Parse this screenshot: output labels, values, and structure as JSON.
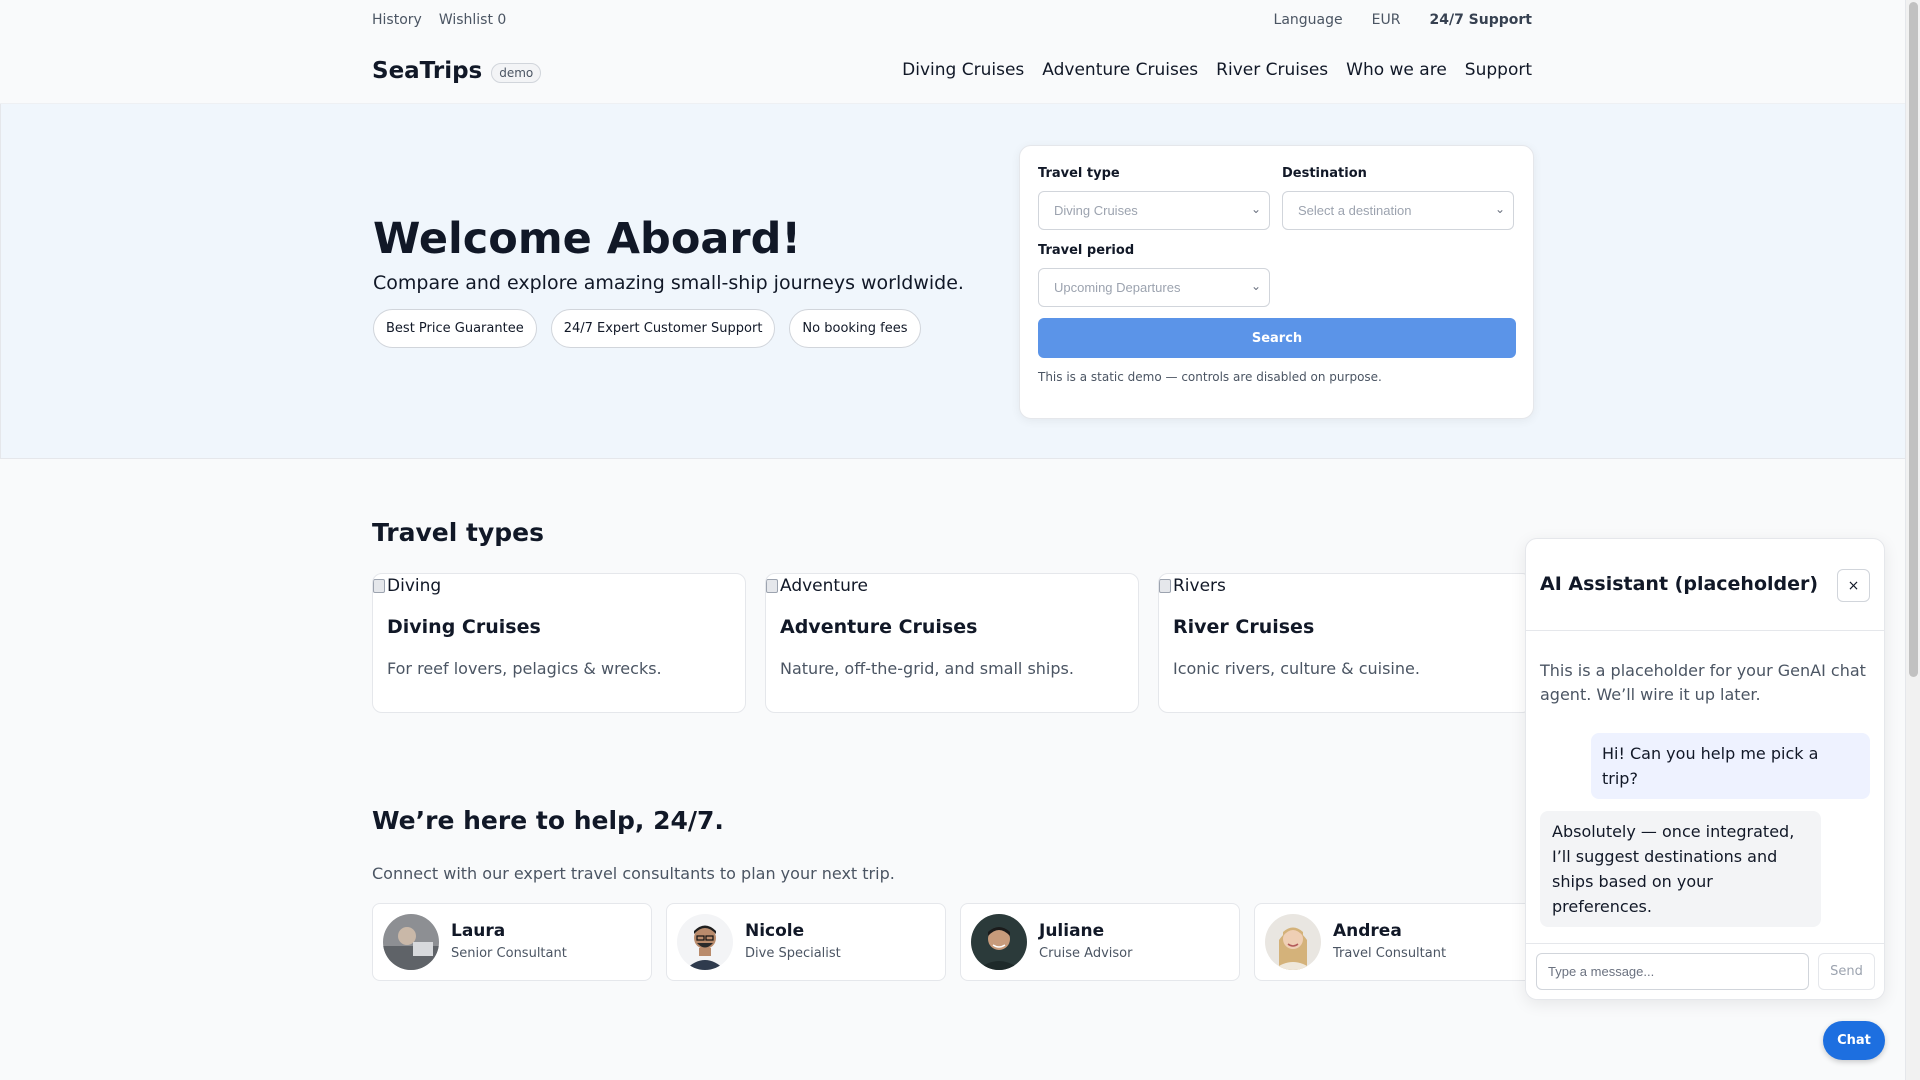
{
  "topbar": {
    "history": "History",
    "wishlist": "Wishlist 0",
    "language": "Language",
    "currency": "EUR",
    "support": "24/7 Support"
  },
  "brand": {
    "name": "SeaTrips",
    "badge": "demo"
  },
  "nav": {
    "items": [
      {
        "label": "Diving Cruises"
      },
      {
        "label": "Adventure Cruises"
      },
      {
        "label": "River Cruises"
      },
      {
        "label": "Who we are"
      },
      {
        "label": "Support"
      }
    ]
  },
  "hero": {
    "title": "Welcome Aboard!",
    "subtitle": "Compare and explore amazing small-ship journeys worldwide.",
    "pills": [
      {
        "label": "Best Price Guarantee"
      },
      {
        "label": "24/7 Expert Customer Support"
      },
      {
        "label": "No booking fees"
      }
    ]
  },
  "search": {
    "travel_type_label": "Travel type",
    "travel_type_value": "Diving Cruises",
    "destination_label": "Destination",
    "destination_value": "Select a destination",
    "period_label": "Travel period",
    "period_value": "Upcoming Departures",
    "button": "Search",
    "note": "This is a static demo — controls are disabled on purpose."
  },
  "travel_types": {
    "title": "Travel types",
    "cards": [
      {
        "alt": "Diving",
        "title": "Diving Cruises",
        "desc": "For reef lovers, pelagics & wrecks."
      },
      {
        "alt": "Adventure",
        "title": "Adventure Cruises",
        "desc": "Nature, off-the-grid, and small ships."
      },
      {
        "alt": "Rivers",
        "title": "River Cruises",
        "desc": "Iconic rivers, culture & cuisine."
      }
    ]
  },
  "help": {
    "title": "We’re here to help, 24/7.",
    "subtitle": "Connect with our expert travel consultants to plan your next trip.",
    "consultants": [
      {
        "name": "Laura",
        "role": "Senior Consultant"
      },
      {
        "name": "Nicole",
        "role": "Dive Specialist"
      },
      {
        "name": "Juliane",
        "role": "Cruise Advisor"
      },
      {
        "name": "Andrea",
        "role": "Travel Consultant"
      }
    ]
  },
  "chat": {
    "title": "AI Assistant (placeholder)",
    "close": "×",
    "intro": "This is a placeholder for your GenAI chat agent. We’ll wire it up later.",
    "user_message": "Hi! Can you help me pick a trip?",
    "bot_message": "Absolutely — once integrated, I’ll suggest destinations and ships based on your preferences.",
    "input_placeholder": "Type a message...",
    "send": "Send",
    "fab": "Chat"
  },
  "colors": {
    "primary": "#1d6fe0",
    "search_button": "#5b94e8",
    "hero_bg": "#f0f6fc"
  }
}
